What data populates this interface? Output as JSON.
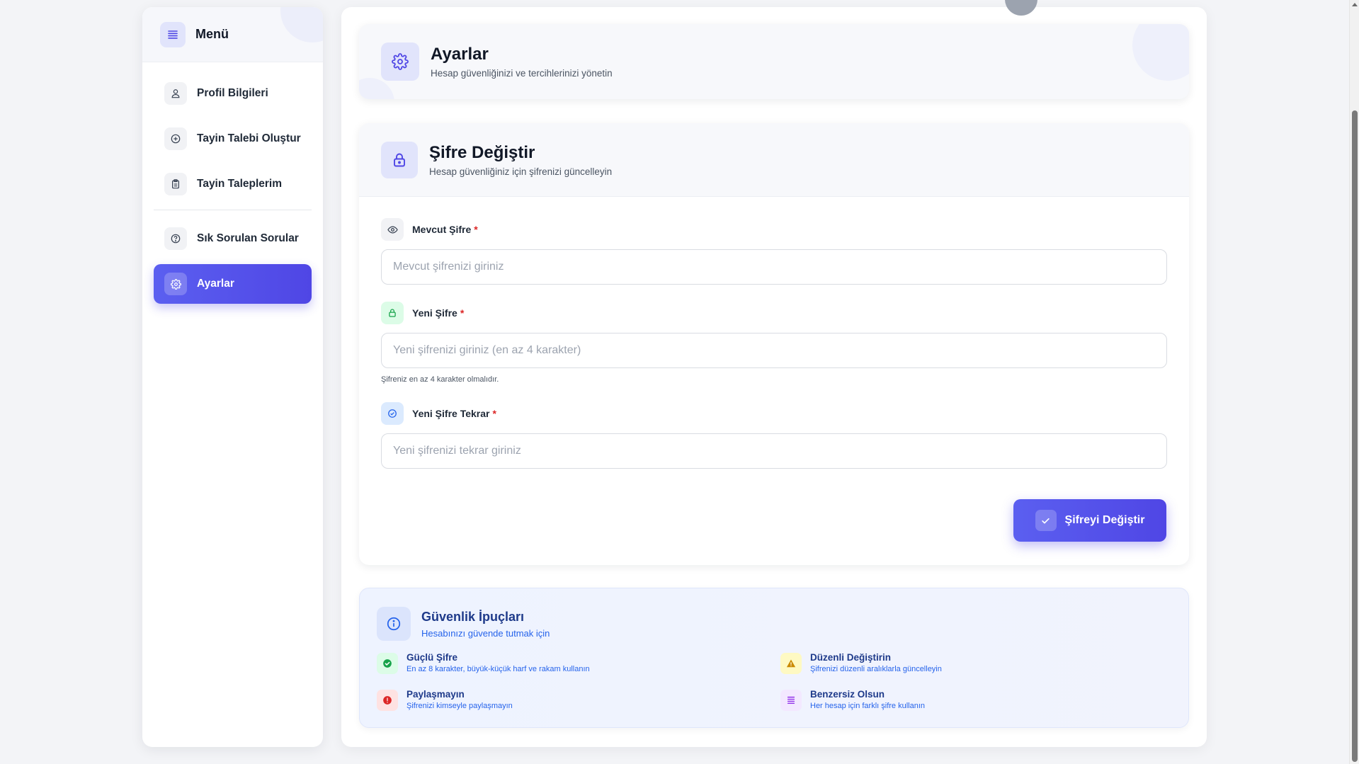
{
  "sidebar": {
    "title": "Menü",
    "menu_icon": "hamburger-icon",
    "items": [
      {
        "label": "Profil Bilgileri",
        "icon": "user-icon"
      },
      {
        "label": "Tayin Talebi Oluştur",
        "icon": "plus-circle-icon"
      },
      {
        "label": "Tayin Taleplerim",
        "icon": "clipboard-icon"
      },
      {
        "label": "Sık Sorulan Sorular",
        "icon": "question-circle-icon"
      },
      {
        "label": "Ayarlar",
        "icon": "gear-icon",
        "active": true
      }
    ]
  },
  "header": {
    "title": "Ayarlar",
    "subtitle": "Hesap güvenliğinizi ve tercihlerinizi yönetin",
    "icon": "gear-icon"
  },
  "password_form": {
    "title": "Şifre Değiştir",
    "subtitle": "Hesap güvenliğiniz için şifrenizi güncelleyin",
    "icon": "lock-icon",
    "current": {
      "label": "Mevcut Şifre",
      "required_mark": "*",
      "placeholder": "Mevcut şifrenizi giriniz",
      "value": "",
      "icon": "eye-icon"
    },
    "new": {
      "label": "Yeni Şifre",
      "required_mark": "*",
      "placeholder": "Yeni şifrenizi giriniz (en az 4 karakter)",
      "value": "",
      "hint": "Şifreniz en az 4 karakter olmalıdır.",
      "icon": "lock-icon"
    },
    "confirm": {
      "label": "Yeni Şifre Tekrar",
      "required_mark": "*",
      "placeholder": "Yeni şifrenizi tekrar giriniz",
      "value": "",
      "icon": "check-circle-icon"
    },
    "submit_label": "Şifreyi Değiştir",
    "submit_icon": "check-icon"
  },
  "tips": {
    "title": "Güvenlik İpuçları",
    "subtitle": "Hesabınızı güvende tutmak için",
    "icon": "info-icon",
    "items": [
      {
        "title": "Güçlü Şifre",
        "text": "En az 8 karakter, büyük-küçük harf ve rakam kullanın",
        "icon": "check-circle-filled-icon",
        "color": "#16a34a"
      },
      {
        "title": "Düzenli Değiştirin",
        "text": "Şifrenizi düzenli aralıklarla güncelleyin",
        "icon": "warning-icon",
        "color": "#ca8a04"
      },
      {
        "title": "Paylaşmayın",
        "text": "Şifrenizi kimseyle paylaşmayın",
        "icon": "alert-circle-icon",
        "color": "#dc2626"
      },
      {
        "title": "Benzersiz Olsun",
        "text": "Her hesap için farklı şifre kullanın",
        "icon": "list-icon",
        "color": "#9333ea"
      }
    ]
  },
  "colors": {
    "accent": "#4f46e5",
    "background": "#f3f4f7",
    "required": "#dc2626",
    "tips_title": "#1e3a8a",
    "tips_text": "#2563eb"
  }
}
